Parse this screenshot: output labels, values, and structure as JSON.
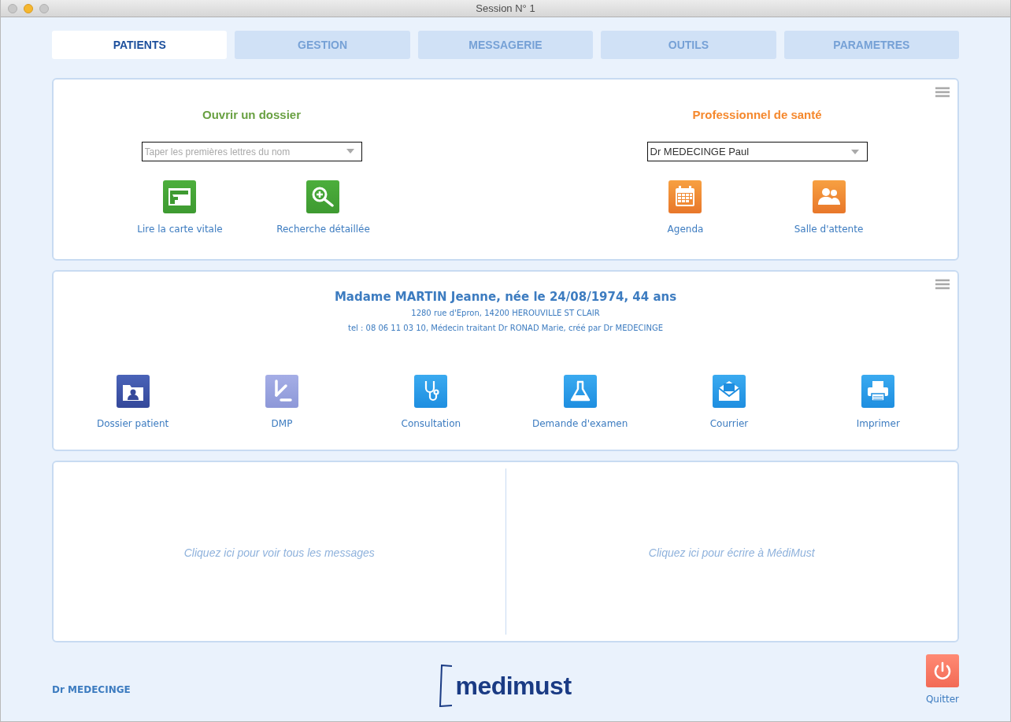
{
  "window": {
    "title": "Session N° 1"
  },
  "tabs": [
    {
      "label": "PATIENTS",
      "selected": true
    },
    {
      "label": "GESTION",
      "selected": false
    },
    {
      "label": "MESSAGERIE",
      "selected": false
    },
    {
      "label": "OUTILS",
      "selected": false
    },
    {
      "label": "PARAMETRES",
      "selected": false
    }
  ],
  "open_file": {
    "title": "Ouvrir un dossier",
    "search": {
      "placeholder": "Taper les premières lettres du nom"
    },
    "actions": [
      "Lire la carte vitale",
      "Recherche détaillée"
    ]
  },
  "practitioner": {
    "title": "Professionnel de santé",
    "select": {
      "value": "Dr MEDECINGE Paul"
    },
    "actions": [
      "Agenda",
      "Salle d'attente"
    ]
  },
  "patient": {
    "name": "Madame MARTIN Jeanne, née le 24/08/1974, 44 ans",
    "address": "1280 rue d'Epron, 14200 HEROUVILLE ST CLAIR",
    "details": "tel : 08 06 11 03 10, Médecin traitant Dr RONAD Marie, créé par Dr MEDECINGE",
    "actions": [
      "Dossier patient",
      "DMP",
      "Consultation",
      "Demande d'examen",
      "Courrier",
      "Imprimer"
    ]
  },
  "messages": {
    "inbox_hint": "Cliquez ici pour voir tous les messages",
    "write_hint": "Cliquez ici pour écrire à MédiMust"
  },
  "footer": {
    "user": "Dr MEDECINGE",
    "logo": "medimust",
    "quit": "Quitter"
  }
}
